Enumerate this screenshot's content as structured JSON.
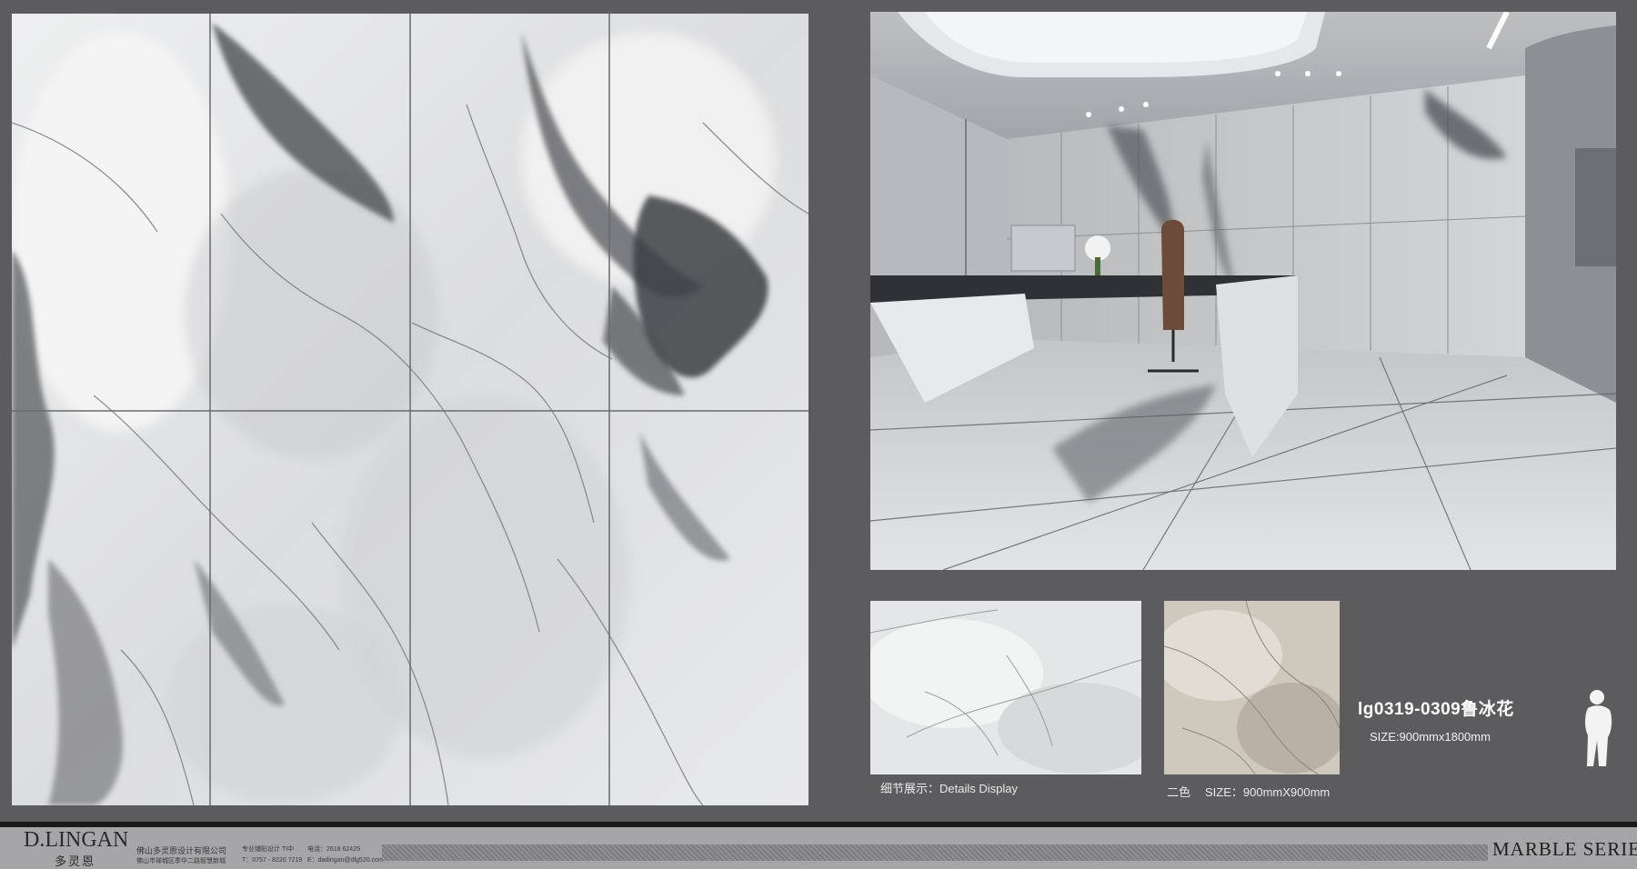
{
  "product": {
    "code": "lg0319-0309鲁冰花",
    "size": "SIZE:900mmx1800mm"
  },
  "details": {
    "caption": "细节展示：Details  Display",
    "alt_color_label": "二色",
    "alt_color_size": "SIZE：900mmX900mm"
  },
  "footer": {
    "brand_name": "D.LINGAN",
    "brand_cn": "多灵恩",
    "company_name": "佛山多灵恩设计有限公司",
    "company_address": "佛山市禅城区季华二路智慧新城",
    "service_line": "专业铺贴设计 TI中",
    "phone": "T：0757 - 8220 7219",
    "contact_code": "电话：2618 62425",
    "email": "E：dadingan@dlg520.com",
    "series": "MARBLE  SERIES"
  },
  "colors": {
    "background": "#5c5b5d",
    "footer": "#a6a6a8",
    "marble_light": "#e4e5e6",
    "marble_vein": "#4a4b4d",
    "beige": "#cfc8bc"
  },
  "icons": {
    "figure": "human-silhouette-icon"
  }
}
